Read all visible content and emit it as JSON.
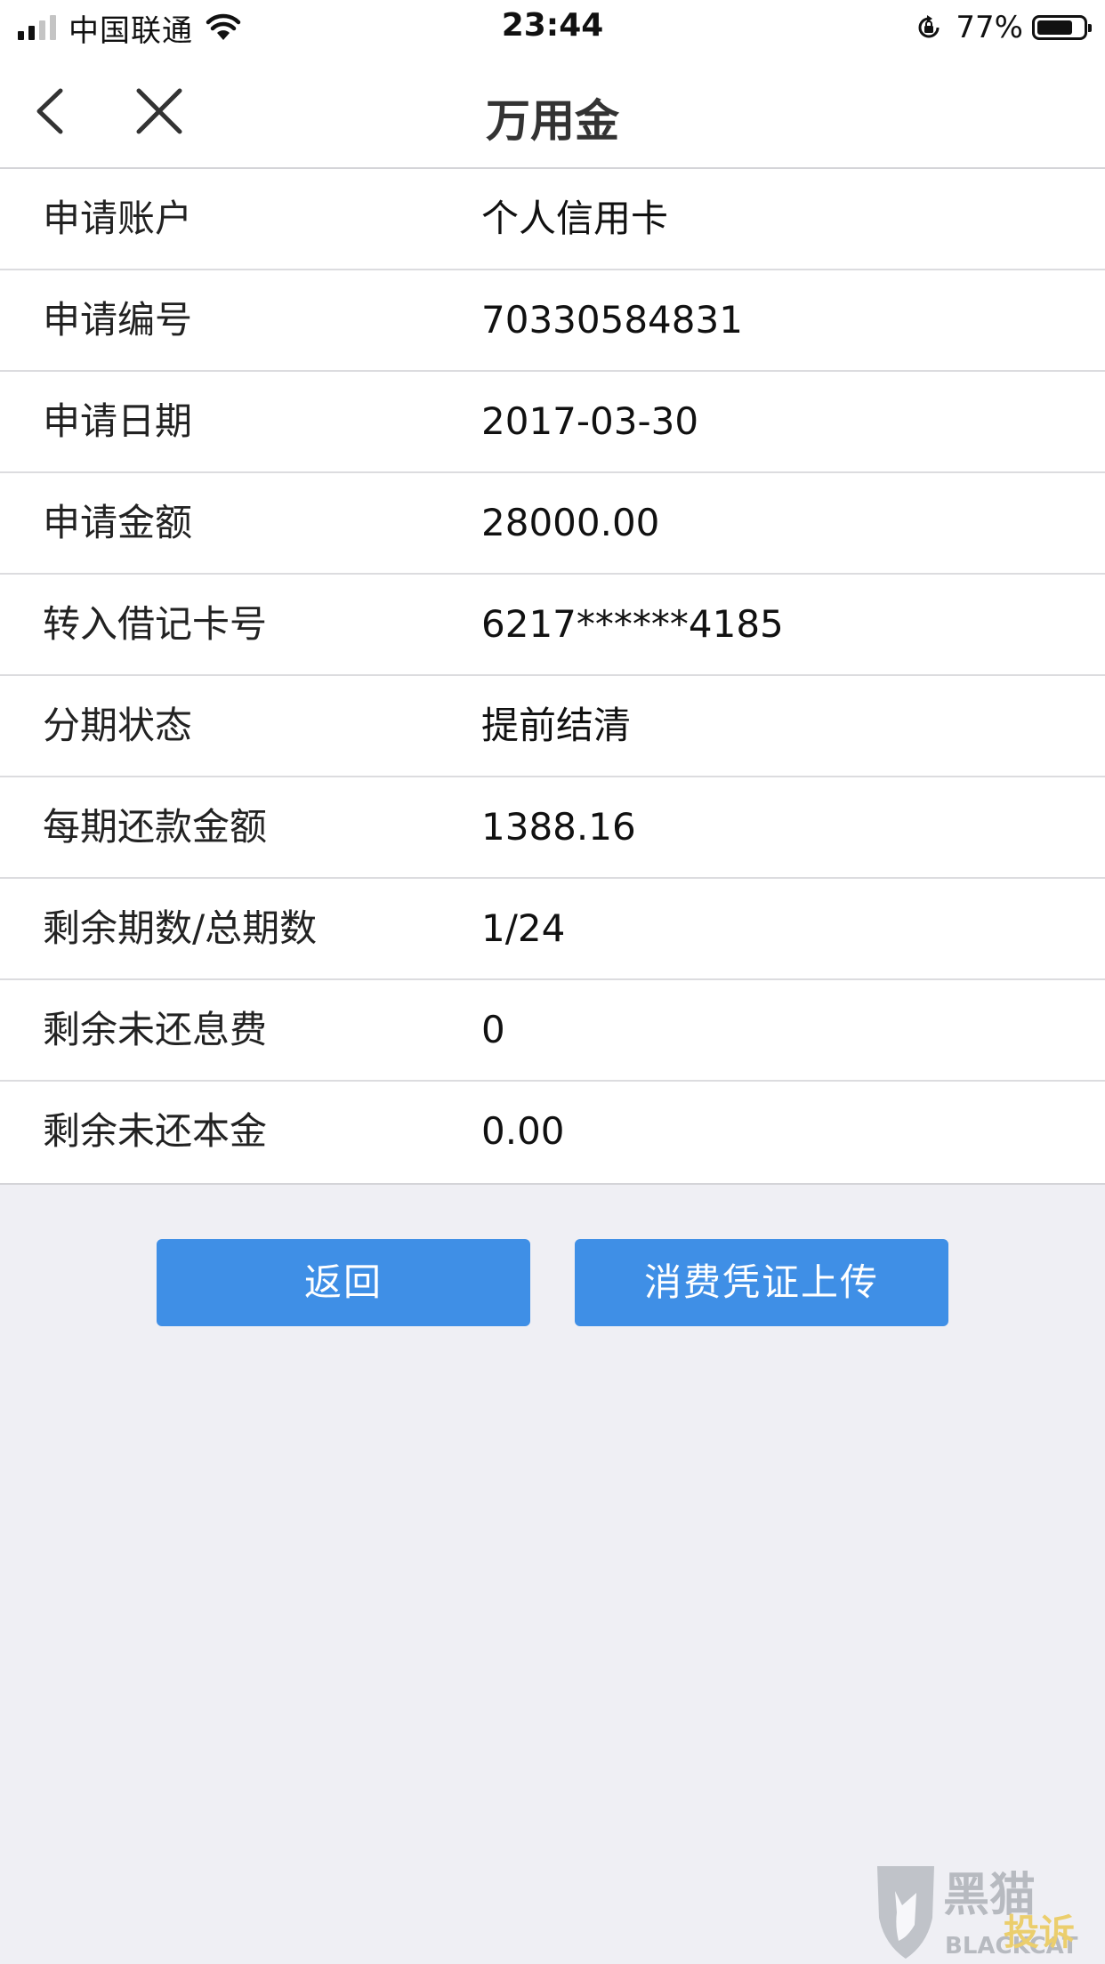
{
  "status_bar": {
    "carrier": "中国联通",
    "time": "23:44",
    "battery_percent": "77%",
    "battery_level": 0.77,
    "signal_bars_filled": 2,
    "signal_bars_total": 4
  },
  "nav": {
    "title": "万用金",
    "back_icon": "chevron-left-icon",
    "close_icon": "close-icon"
  },
  "details": [
    {
      "label": "申请账户",
      "value": "个人信用卡"
    },
    {
      "label": "申请编号",
      "value": "70330584831"
    },
    {
      "label": "申请日期",
      "value": "2017-03-30"
    },
    {
      "label": "申请金额",
      "value": "28000.00"
    },
    {
      "label": "转入借记卡号",
      "value": "6217******4185"
    },
    {
      "label": "分期状态",
      "value": "提前结清"
    },
    {
      "label": "每期还款金额",
      "value": "1388.16"
    },
    {
      "label": "剩余期数/总期数",
      "value": "1/24"
    },
    {
      "label": "剩余未还息费",
      "value": "0"
    },
    {
      "label": "剩余未还本金",
      "value": "0.00"
    }
  ],
  "buttons": {
    "back_label": "返回",
    "upload_label": "消费凭证上传"
  },
  "watermark": {
    "text": "黑猫",
    "subtext": "BLACKCAT",
    "overlay_text": "投诉"
  },
  "colors": {
    "accent": "#3f8fe6",
    "background": "#efeff4"
  }
}
